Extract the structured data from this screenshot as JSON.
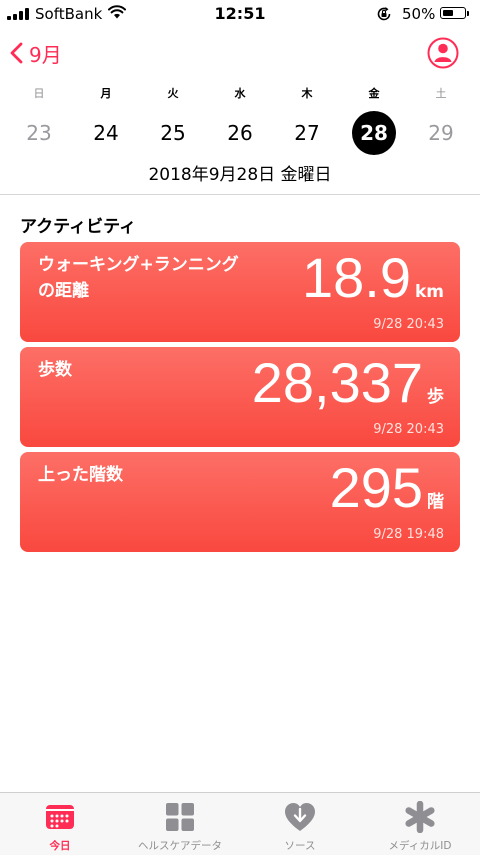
{
  "status": {
    "carrier": "SoftBank",
    "time": "12:51",
    "battery": "50%",
    "battery_level": 0.5
  },
  "nav": {
    "back_label": "9月"
  },
  "week": {
    "days": [
      "日",
      "月",
      "火",
      "水",
      "木",
      "金",
      "土"
    ],
    "dates": [
      "23",
      "24",
      "25",
      "26",
      "27",
      "28",
      "29"
    ],
    "selected_index": 5
  },
  "full_date": "2018年9月28日 金曜日",
  "section_title": "アクティビティ",
  "cards": [
    {
      "title": "ウォーキング+ランニング\nの距離",
      "value": "18.9",
      "unit": "km",
      "time": "9/28 20:43"
    },
    {
      "title": "歩数",
      "value": "28,337",
      "unit": "歩",
      "time": "9/28 20:43"
    },
    {
      "title": "上った階数",
      "value": "295",
      "unit": "階",
      "time": "9/28 19:48"
    }
  ],
  "tabs": [
    {
      "label": "今日",
      "icon": "calendar-icon",
      "active": true
    },
    {
      "label": "ヘルスケアデータ",
      "icon": "grid-icon",
      "active": false
    },
    {
      "label": "ソース",
      "icon": "heart-download-icon",
      "active": false
    },
    {
      "label": "メディカルID",
      "icon": "asterisk-icon",
      "active": false
    }
  ],
  "colors": {
    "accent": "#ff2d55",
    "card_top": "#fd6f66",
    "card_bottom": "#f9483f"
  }
}
